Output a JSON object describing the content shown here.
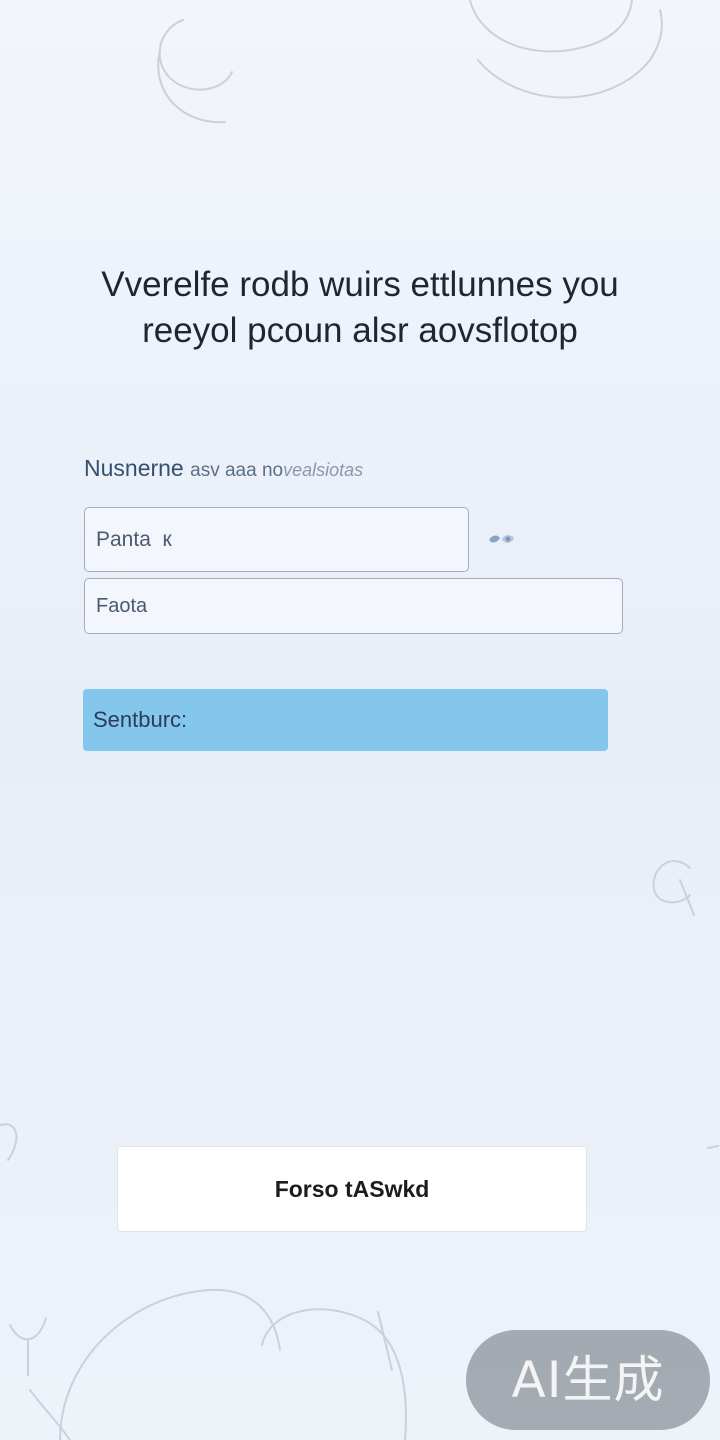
{
  "headline": {
    "line1": "Vverelfe rodb wuirs ettlunnes you",
    "line2": "reeyol pcoun alsr aovsflotoр"
  },
  "form": {
    "label_part1": "Nusnerne",
    "label_part2": "asv aaa no",
    "label_part3": "vealsiotas",
    "field1_value": "Panta  к",
    "field2_value": "Faota",
    "eye_icon": "eye-icon",
    "submit_label": "Sentburc:"
  },
  "footer": {
    "forgot_label": "Forso tASwkd"
  },
  "watermark": {
    "text": "AI生成"
  },
  "colors": {
    "background": "#edf2f9",
    "primary_button": "#85c6ec",
    "input_border": "#a3adbd",
    "label": "#3f5878"
  }
}
